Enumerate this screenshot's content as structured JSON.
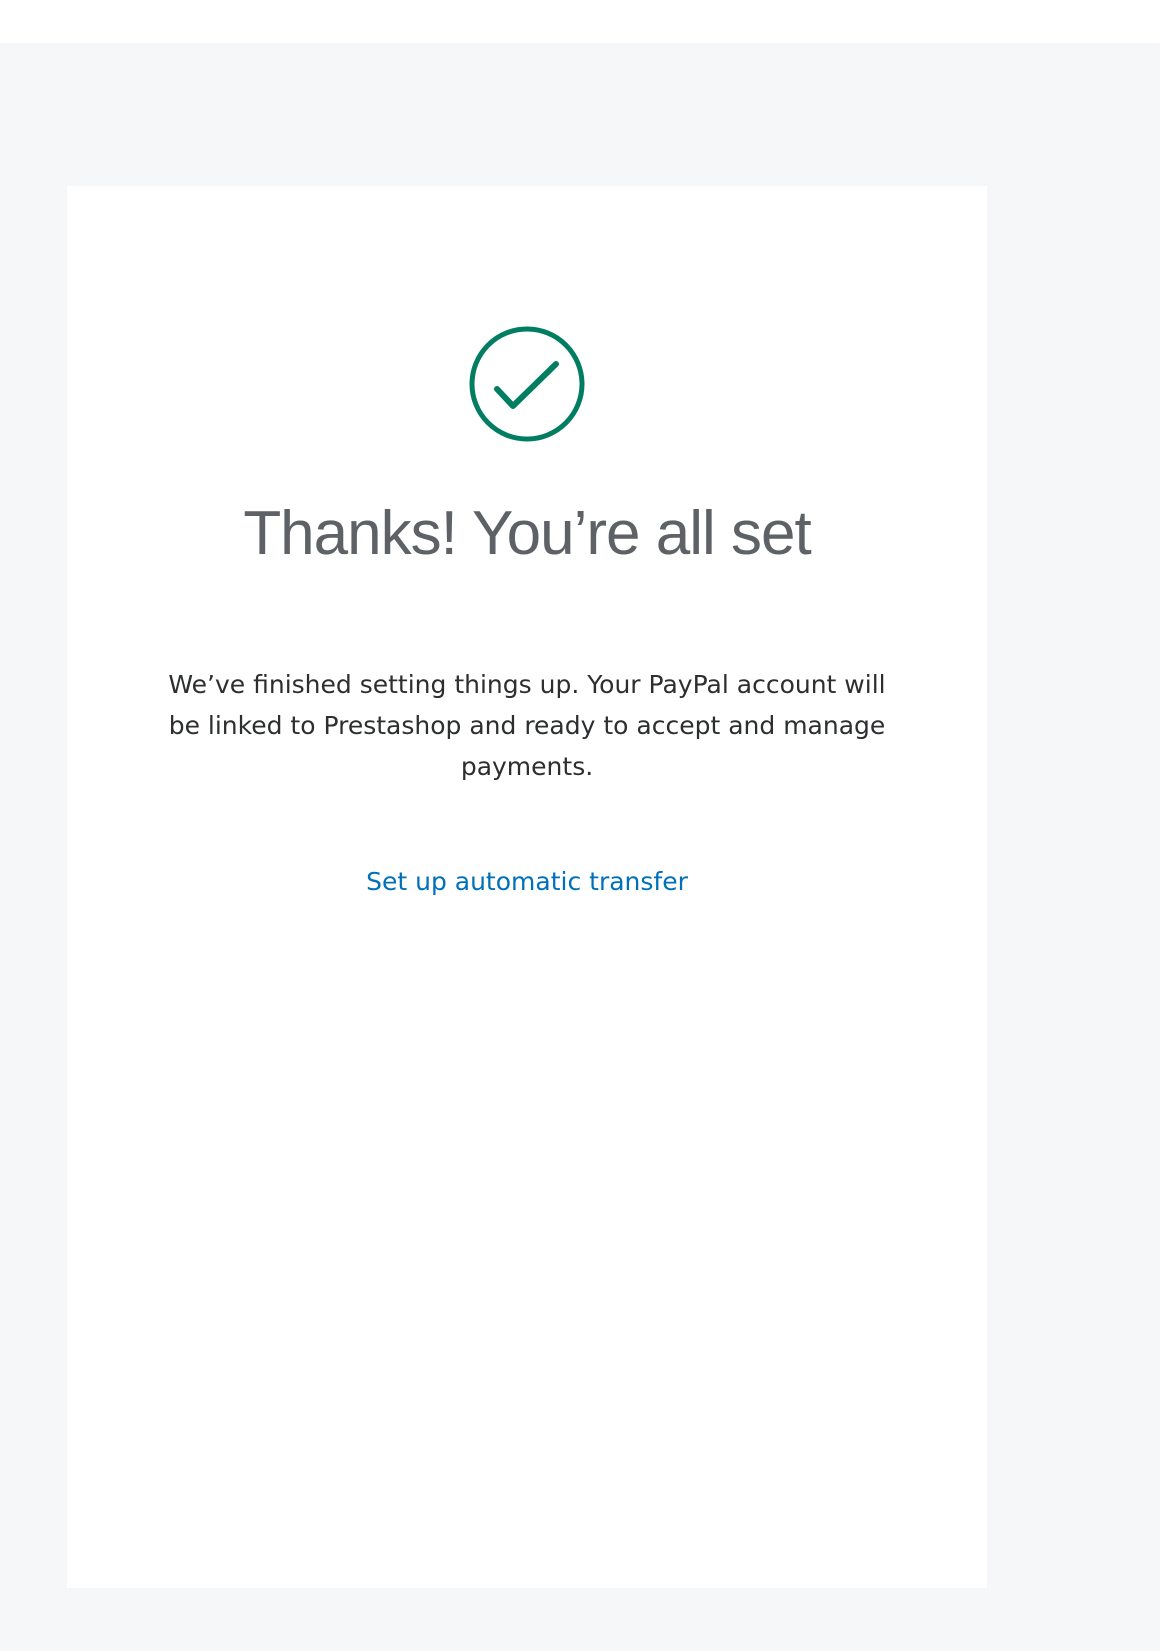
{
  "colors": {
    "page_background": "#f6f7f9",
    "card_background": "#ffffff",
    "success_green": "#017e62",
    "title_gray": "#5e6166",
    "body_text": "#2c2e2f",
    "link_blue": "#0070ba"
  },
  "confirmation": {
    "icon": "check-circle-icon",
    "title": "Thanks! You’re all set",
    "message": "We’ve finished setting things up. Your PayPal account will be linked to Prestashop and ready to accept and manage payments.",
    "link_label": "Set up automatic transfer"
  }
}
